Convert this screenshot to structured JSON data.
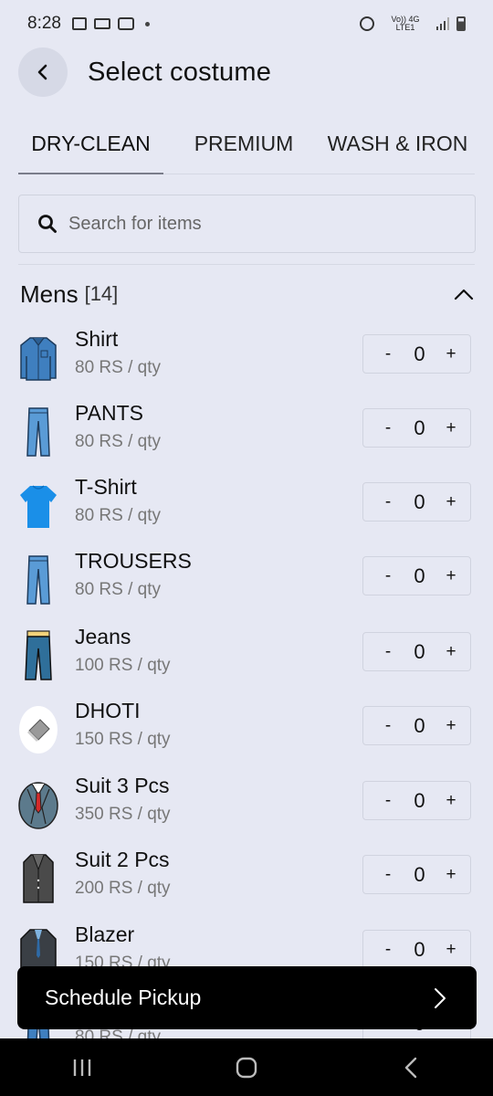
{
  "status_bar": {
    "time": "8:28",
    "network_label": "Vo)) 4G LTE1"
  },
  "header": {
    "title": "Select costume"
  },
  "tabs": [
    {
      "label": "DRY-CLEAN",
      "active": true
    },
    {
      "label": "PREMIUM",
      "active": false
    },
    {
      "label": "WASH & IRON",
      "active": false
    }
  ],
  "search": {
    "placeholder": "Search for items"
  },
  "section": {
    "title": "Mens",
    "count": "[14]"
  },
  "items": [
    {
      "name": "Shirt",
      "price": "80 RS / qty",
      "qty": "0",
      "icon": "shirt-icon"
    },
    {
      "name": "PANTS",
      "price": "80 RS / qty",
      "qty": "0",
      "icon": "pants-icon"
    },
    {
      "name": "T-Shirt",
      "price": "80 RS / qty",
      "qty": "0",
      "icon": "tshirt-icon"
    },
    {
      "name": "TROUSERS",
      "price": "80 RS / qty",
      "qty": "0",
      "icon": "trousers-icon"
    },
    {
      "name": "Jeans",
      "price": "100 RS / qty",
      "qty": "0",
      "icon": "jeans-icon"
    },
    {
      "name": "DHOTI",
      "price": "150 RS / qty",
      "qty": "0",
      "icon": "dhoti-icon"
    },
    {
      "name": "Suit 3 Pcs",
      "price": "350 RS / qty",
      "qty": "0",
      "icon": "suit-3pcs-icon"
    },
    {
      "name": "Suit 2 Pcs",
      "price": "200 RS / qty",
      "qty": "0",
      "icon": "suit-2pcs-icon"
    },
    {
      "name": "Blazer",
      "price": "150 RS / qty",
      "qty": "0",
      "icon": "blazer-icon"
    },
    {
      "name": "",
      "price": "80 RS / qty",
      "qty": "0",
      "icon": "pants-icon"
    }
  ],
  "qty_controls": {
    "minus": "-",
    "plus": "+"
  },
  "schedule_button": {
    "label": "Schedule Pickup"
  },
  "colors": {
    "background": "#e6e8f3",
    "button_bg": "#000000",
    "denim": "#3f7fbf",
    "tshirt": "#1a8fe8"
  }
}
